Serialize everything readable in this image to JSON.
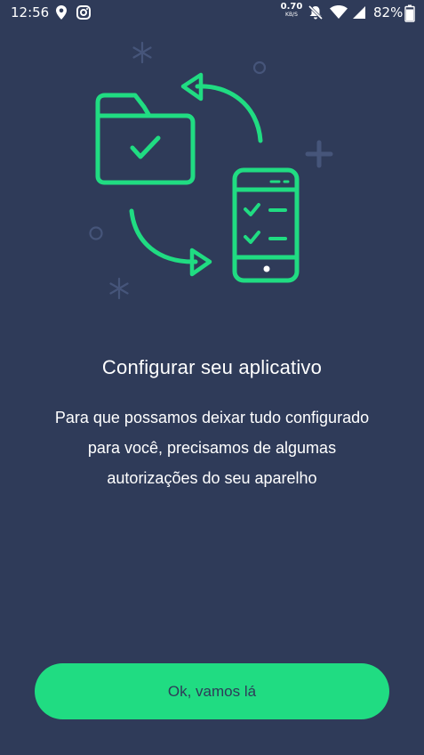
{
  "status_bar": {
    "time": "12:56",
    "network_speed_value": "0.70",
    "network_speed_unit": "KB/S",
    "battery_percent": "82%",
    "icons": [
      "location-icon",
      "instagram-icon",
      "mute-icon",
      "wifi-icon",
      "signal-icon",
      "battery-icon"
    ]
  },
  "illustration": {
    "icons": [
      "folder-check-icon",
      "phone-checklist-icon",
      "sync-arrows-icon"
    ],
    "accent_color": "#20dc82",
    "background_color": "#2f3b59"
  },
  "main": {
    "title": "Configurar seu aplicativo",
    "description_lines": [
      "Para que possamos deixar tudo configurado",
      "para você, precisamos de algumas",
      "autorizações do seu aparelho"
    ]
  },
  "actions": {
    "ok_label": "Ok, vamos lá"
  }
}
